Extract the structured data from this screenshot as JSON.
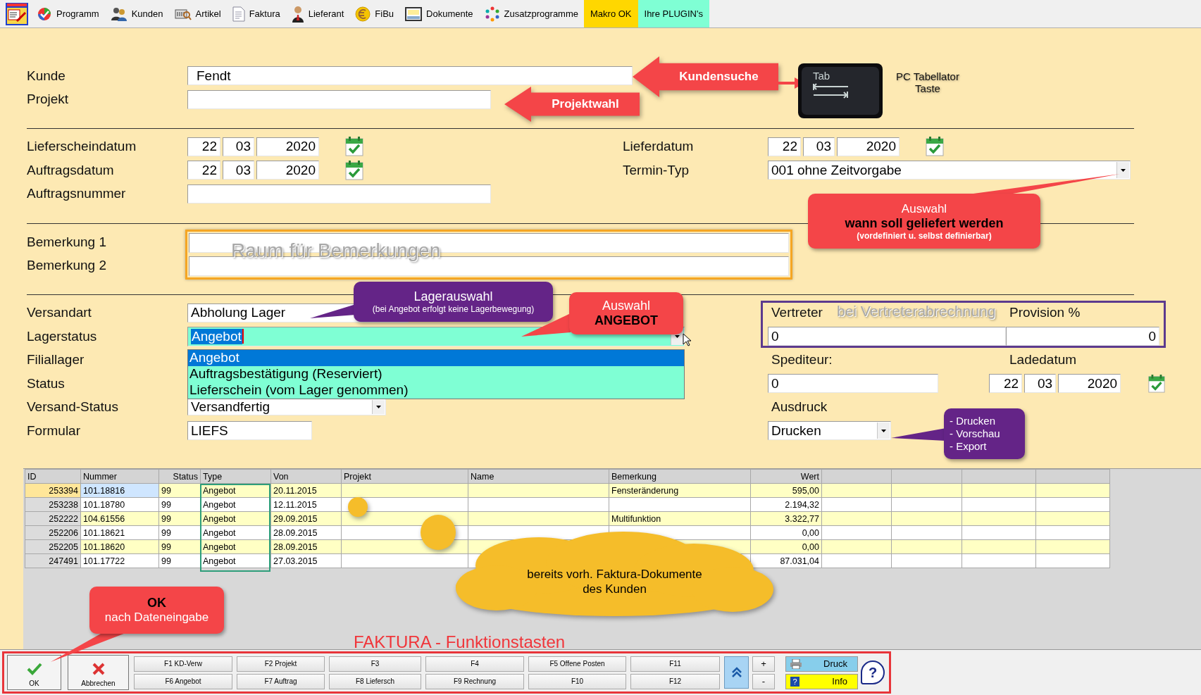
{
  "menu_bar": {
    "items": [
      {
        "label": "Programm"
      },
      {
        "label": "Kunden"
      },
      {
        "label": "Artikel"
      },
      {
        "label": "Faktura"
      },
      {
        "label": "Lieferant"
      },
      {
        "label": "FiBu"
      },
      {
        "label": "Dokumente"
      },
      {
        "label": "Zusatzprogramme"
      },
      {
        "label": "Makro OK",
        "color": "#ffd700"
      },
      {
        "label": "Ihre PLUGIN's",
        "color": "#7fffd4"
      }
    ]
  },
  "header": {
    "customer": {
      "label": "Kunde",
      "value": "Fendt"
    },
    "project": {
      "label": "Projekt"
    }
  },
  "dates": {
    "delivery_note_date": {
      "label": "Lieferscheindatum",
      "day": "22",
      "month": "03",
      "year": "2020"
    },
    "order_date": {
      "label": "Auftragsdatum",
      "day": "22",
      "month": "03",
      "year": "2020"
    },
    "order_number": {
      "label": "Auftragsnummer"
    },
    "delivery_date": {
      "label": "Lieferdatum",
      "day": "22",
      "month": "03",
      "year": "2020"
    },
    "schedule_type": {
      "label": "Termin-Typ",
      "value": "001 ohne Zeitvorgabe"
    }
  },
  "remarks": [
    {
      "label": "Bemerkung 1"
    },
    {
      "label": "Bemerkung 2"
    }
  ],
  "shipping": {
    "shipping_method": {
      "label": "Versandart",
      "value": "Abholung Lager"
    },
    "stock_status": {
      "label": "Lagerstatus",
      "value": "Angebot",
      "expanded": true,
      "options": [
        {
          "label": "Angebot",
          "selected": true
        },
        {
          "label": "Auftragsbestätigung (Reserviert)",
          "selected": false
        },
        {
          "label": "Lieferschein (vom Lager genommen)",
          "selected": false
        }
      ]
    },
    "branch_stock": {
      "label": "Filiallager"
    },
    "status": {
      "label": "Status"
    },
    "shipping_status": {
      "label": "Versand-Status",
      "value": "Versandfertig"
    },
    "form": {
      "label": "Formular",
      "value": "LIEFS"
    }
  },
  "agent": {
    "agent": {
      "label": "Vertreter",
      "value": "0"
    },
    "commission": {
      "label": "Provision %",
      "value": "0"
    },
    "forwarder": {
      "label": "Spediteur:",
      "value": "0"
    },
    "loading_date": {
      "label": "Ladedatum",
      "day": "22",
      "month": "03",
      "year": "2020"
    },
    "printout": {
      "label": "Ausdruck",
      "value": "Drucken"
    }
  },
  "table": {
    "columns": [
      "ID",
      "Nummer",
      "Status",
      "Type",
      "Von",
      "Projekt",
      "Name",
      "Bemerkung",
      "Wert"
    ],
    "rows": [
      {
        "id": "253394",
        "number": "101.18816",
        "status": "99",
        "type": "Angebot",
        "from": "20.11.2015",
        "remark": "Fensteränderung",
        "value": "595,00",
        "selected": true
      },
      {
        "id": "253238",
        "number": "101.18780",
        "status": "99",
        "type": "Angebot",
        "from": "12.11.2015",
        "value": "2.194,32",
        "selected": false
      },
      {
        "id": "252222",
        "number": "104.61556",
        "status": "99",
        "type": "Angebot",
        "from": "29.09.2015",
        "remark": "Multifunktion",
        "value": "3.322,77",
        "selected": false
      },
      {
        "id": "252206",
        "number": "101.18621",
        "status": "99",
        "type": "Angebot",
        "from": "28.09.2015",
        "value": "0,00",
        "selected": false
      },
      {
        "id": "252205",
        "number": "101.18620",
        "status": "99",
        "type": "Angebot",
        "from": "28.09.2015",
        "value": "0,00",
        "selected": false
      },
      {
        "id": "247491",
        "number": "101.17722",
        "status": "99",
        "type": "Angebot",
        "from": "27.03.2015",
        "value": "87.031,04",
        "selected": false
      }
    ]
  },
  "footer": {
    "ok": "OK",
    "cancel": "Abbrechen",
    "function_keys": [
      {
        "label": "F1 KD-Verw"
      },
      {
        "label": "F2 Projekt"
      },
      {
        "label": "F3"
      },
      {
        "label": "F4"
      },
      {
        "label": "F5 Offene Posten"
      },
      {
        "label": "F11"
      },
      {
        "label": "F6 Angebot"
      },
      {
        "label": "F7 Auftrag"
      },
      {
        "label": "F8 Liefersch"
      },
      {
        "label": "F9 Rechnung"
      },
      {
        "label": "F10"
      },
      {
        "label": "F12"
      }
    ],
    "zoom": [
      "+",
      "-"
    ],
    "print": "Druck",
    "info": "Info",
    "info_glyph": "?",
    "help_glyph": "?"
  },
  "annotations": {
    "customer_search": "Kundensuche",
    "project_choice": "Projektwahl",
    "tab_key": {
      "key": "Tab",
      "caption": "PC Tabellator Taste"
    },
    "schedule_hint": {
      "title": "Auswahl",
      "emphasis": "wann soll geliefert werden",
      "note": "(vordefiniert u. selbst definierbar)"
    },
    "remarks_hint": "Raum für Bemerkungen",
    "stock_hint": {
      "title": "Lagerauswahl",
      "note": "(bei Angebot erfolgt keine Lagerbewegung)"
    },
    "offer_hint": {
      "title": "Auswahl",
      "emphasis": "ANGEBOT"
    },
    "agent_hint": "bei Vertreterabrechnung",
    "print_hint": [
      "- Drucken",
      "- Vorschau",
      "- Export"
    ],
    "documents_hint": [
      "bereits vorh. Faktura-Dokumente",
      "des Kunden"
    ],
    "ok_hint": {
      "title": "OK",
      "note": "nach Dateneingabe"
    },
    "function_keys_hint": "FAKTURA - Funktionstasten"
  }
}
